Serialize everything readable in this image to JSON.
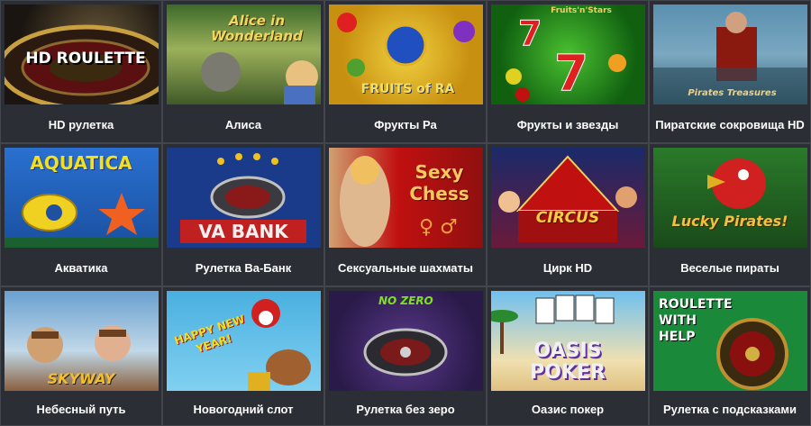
{
  "games": [
    {
      "title": "HD рулетка",
      "logo": "HD ROULETTE"
    },
    {
      "title": "Алиса",
      "logo": "Alice in Wonderland"
    },
    {
      "title": "Фрукты Ра",
      "logo": "FRUITS of RA"
    },
    {
      "title": "Фрукты и звезды",
      "logo": "Fruits'n'Stars"
    },
    {
      "title": "Пиратские сокровища HD",
      "logo": "Pirates Treasures"
    },
    {
      "title": "Акватика",
      "logo": "AQUATICA"
    },
    {
      "title": "Рулетка Ва-Банк",
      "logo": "VA BANK"
    },
    {
      "title": "Сексуальные шахматы",
      "logo": "Sexy Chess"
    },
    {
      "title": "Цирк HD",
      "logo": "CIRCUS"
    },
    {
      "title": "Веселые пираты",
      "logo": "Lucky Pirates!"
    },
    {
      "title": "Небесный путь",
      "logo": "SKYWAY"
    },
    {
      "title": "Новогодний слот",
      "logo": "HAPPY NEW YEAR!"
    },
    {
      "title": "Рулетка без зеро",
      "logo": "NO ZERO"
    },
    {
      "title": "Оазис покер",
      "logo": "OASIS POKER"
    },
    {
      "title": "Рулетка с подсказками",
      "logo": "ROULETTE WITH HELP"
    }
  ]
}
